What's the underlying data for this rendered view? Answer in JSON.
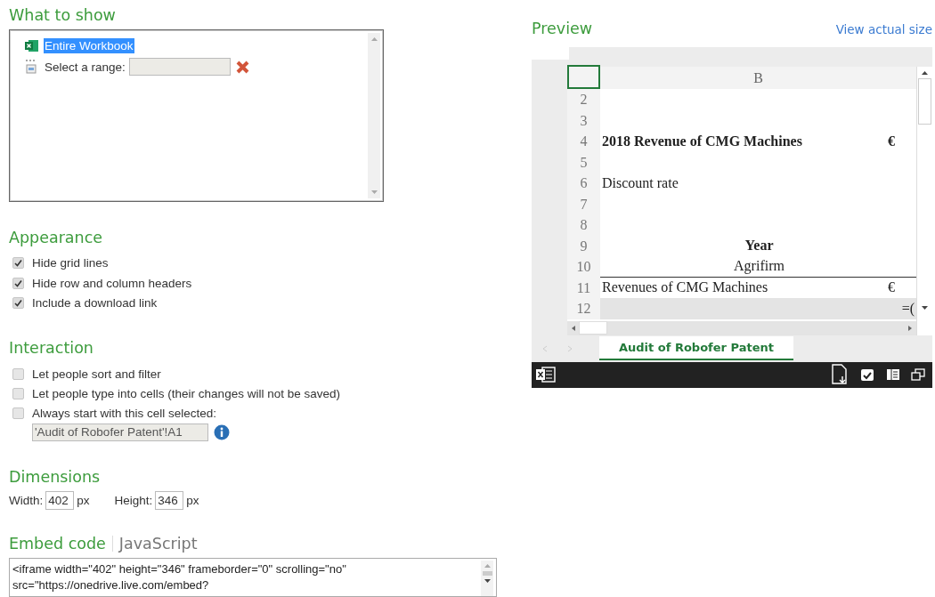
{
  "what_to_show": {
    "title": "What to show",
    "items": [
      {
        "kind": "workbook",
        "label": "Entire Workbook",
        "selected": true
      },
      {
        "kind": "range",
        "label": "Select a range:",
        "selected": false
      }
    ]
  },
  "appearance": {
    "title": "Appearance",
    "options": [
      {
        "label": "Hide grid lines",
        "checked": true
      },
      {
        "label": "Hide row and column headers",
        "checked": true
      },
      {
        "label": "Include a download link",
        "checked": true
      }
    ]
  },
  "interaction": {
    "title": "Interaction",
    "options": [
      {
        "label": "Let people sort and filter",
        "checked": false
      },
      {
        "label": "Let people type into cells (their changes will not be saved)",
        "checked": false
      },
      {
        "label": "Always start with this cell selected:",
        "checked": false
      }
    ],
    "cell_field": {
      "value": "'Audit of Robofer Patent'!A1",
      "disabled": true
    }
  },
  "dimensions": {
    "title": "Dimensions",
    "fields": [
      {
        "label": "Width:",
        "value": "402",
        "unit": "px"
      },
      {
        "label": "Height:",
        "value": "346",
        "unit": "px"
      }
    ]
  },
  "embed": {
    "tabs": [
      {
        "label": "Embed code",
        "selected": true
      },
      {
        "label": "JavaScript",
        "selected": false
      }
    ],
    "code": "<iframe width=\"402\" height=\"346\" frameborder=\"0\" scrolling=\"no\"\nsrc=\"https://onedrive.live.com/embed?"
  },
  "preview": {
    "title": "Preview",
    "link": "View actual size",
    "column_header": "B",
    "rows": [
      {
        "number": "2",
        "selected": false
      },
      {
        "number": "3",
        "selected": false
      },
      {
        "number": "4",
        "text": "2018 Revenue of CMG Machines",
        "bold": true,
        "centered": false,
        "value": "€",
        "selected": false
      },
      {
        "number": "5",
        "selected": false
      },
      {
        "number": "6",
        "text": "Discount rate",
        "centered": false,
        "selected": false
      },
      {
        "number": "7",
        "selected": false
      },
      {
        "number": "8",
        "selected": false
      },
      {
        "number": "9",
        "text": "Year",
        "bold": true,
        "centered": true,
        "selected": false
      },
      {
        "number": "10",
        "text": "Agrifirm",
        "centered": true,
        "border_below": true,
        "selected": false
      },
      {
        "number": "11",
        "text": "Revenues of CMG Machines",
        "centered": false,
        "value": "€",
        "selected": false
      },
      {
        "number": "12",
        "value": "=(",
        "selected": true
      }
    ],
    "sheet_tabs": [
      {
        "label": "Audit of Robofer Patent",
        "selected": true
      }
    ]
  }
}
